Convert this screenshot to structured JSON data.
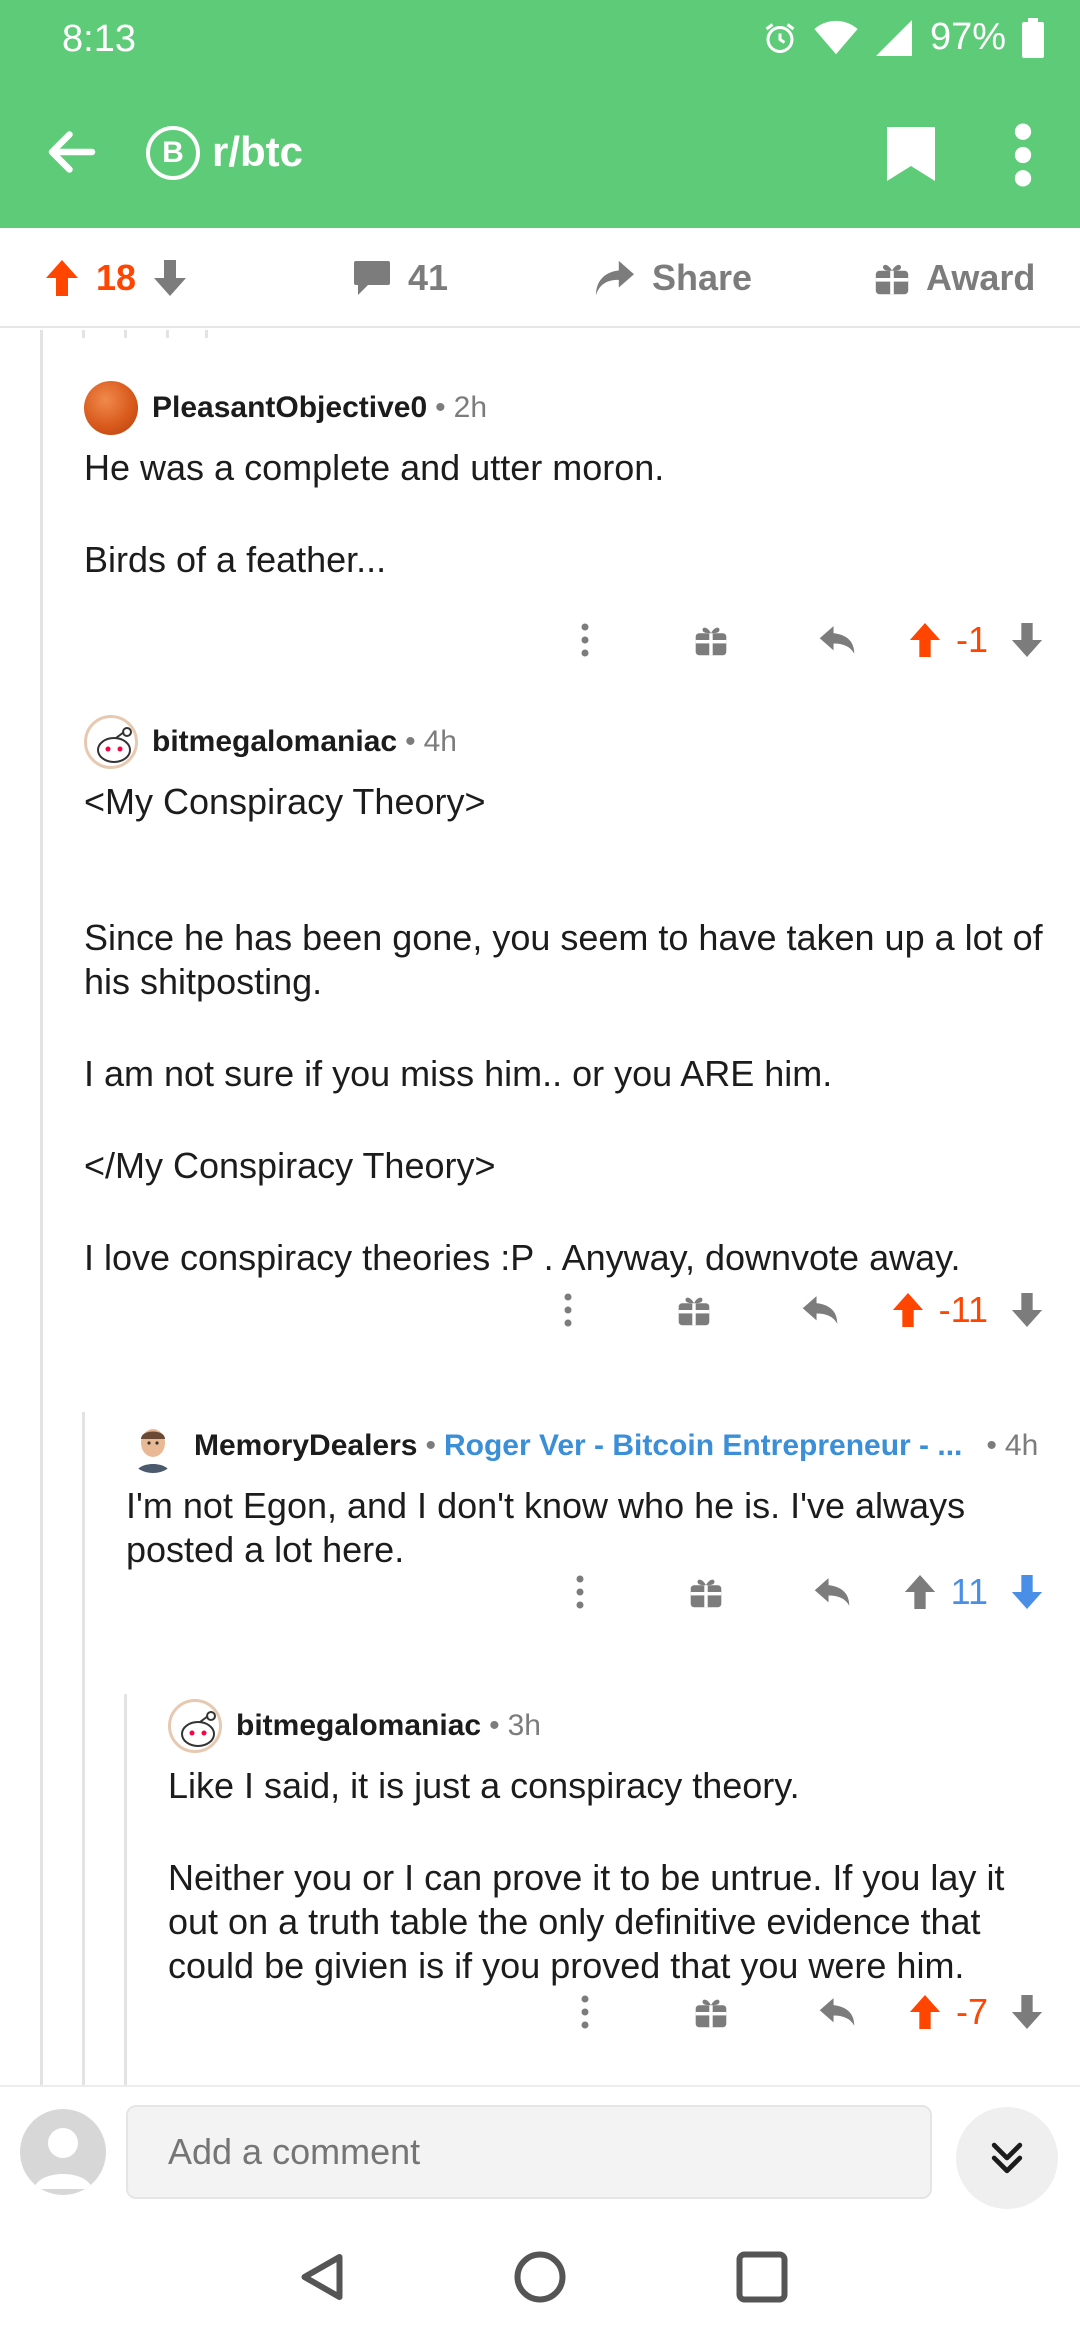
{
  "status": {
    "time": "8:13",
    "battery": "97%"
  },
  "app": {
    "subreddit": "r/btc",
    "subreddit_icon_letter": "B",
    "accent": "#5ecb78"
  },
  "post_actions": {
    "score": "18",
    "comments": "41",
    "share": "Share",
    "award": "Award"
  },
  "comments": [
    {
      "author": "PleasantObjective0",
      "age": "2h",
      "body": [
        "He was a complete and utter moron.",
        "Birds of a feather..."
      ],
      "score": "-1",
      "vote": "up"
    },
    {
      "author": "bitmegalomaniac",
      "age": "4h",
      "body": [
        "<My Conspiracy Theory>",
        "",
        "Since he has been gone, you seem to have taken up a lot of his shitposting.",
        "I am not sure if you miss him.. or you ARE him.",
        "</My Conspiracy Theory>",
        "I love conspiracy theories :P .  Anyway, downvote away."
      ],
      "score": "-11",
      "vote": "up"
    },
    {
      "author": "MemoryDealers",
      "flair": "Roger Ver - Bitcoin Entrepreneur - ...",
      "age": "4h",
      "body": [
        "I'm not Egon, and I don't know who he is.  I've always posted a lot here."
      ],
      "score": "11",
      "vote": "down"
    },
    {
      "author": "bitmegalomaniac",
      "age": "3h",
      "body": [
        "Like I said, it is just a conspiracy theory.",
        "Neither you or I can prove it to be untrue.  If you lay it out on a truth table the only definitive evidence that could be givien is if you proved that you were him."
      ],
      "score": "-7",
      "vote": "up"
    }
  ],
  "composer": {
    "placeholder": "Add a comment"
  },
  "colors": {
    "upvote": "#ff4500",
    "downvote": "#4a8fe7",
    "flair": "#3a8fd8"
  }
}
